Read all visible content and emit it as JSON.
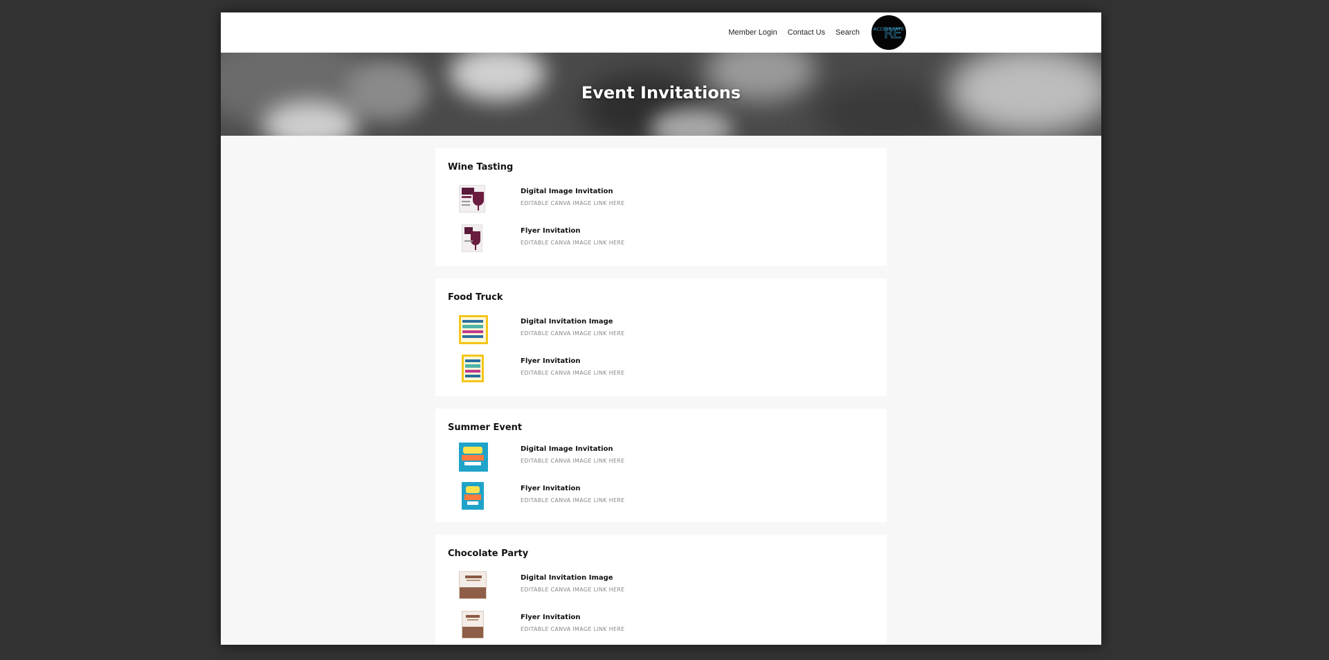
{
  "header": {
    "nav": [
      "Member Login",
      "Contact Us",
      "Search"
    ],
    "logo_text": "ACCELERATE",
    "logo_mark": "RE"
  },
  "hero": {
    "title": "Event Invitations"
  },
  "sections": [
    {
      "title": "Wine Tasting",
      "items": [
        {
          "title": "Digital Image Invitation",
          "link": "EDITABLE CANVA IMAGE LINK HERE"
        },
        {
          "title": "Flyer Invitation",
          "link": "EDITABLE CANVA IMAGE LINK HERE"
        }
      ]
    },
    {
      "title": "Food Truck",
      "items": [
        {
          "title": "Digital Invitation Image",
          "link": "EDITABLE CANVA IMAGE LINK HERE"
        },
        {
          "title": "Flyer Invitation",
          "link": "EDITABLE CANVA IMAGE LINK HERE"
        }
      ]
    },
    {
      "title": "Summer Event",
      "items": [
        {
          "title": "Digital Image Invitation",
          "link": "EDITABLE CANVA IMAGE LINK HERE"
        },
        {
          "title": "Flyer Invitation",
          "link": "EDITABLE CANVA IMAGE LINK HERE"
        }
      ]
    },
    {
      "title": "Chocolate Party",
      "items": [
        {
          "title": "Digital Invitation Image",
          "link": "EDITABLE CANVA IMAGE LINK HERE"
        },
        {
          "title": "Flyer Invitation",
          "link": "EDITABLE CANVA IMAGE LINK HERE"
        }
      ]
    }
  ],
  "colors": {
    "backdrop": "#333333",
    "page": "#f7f7f7",
    "card": "#ffffff",
    "logo_accent": "#3fa9d6"
  }
}
